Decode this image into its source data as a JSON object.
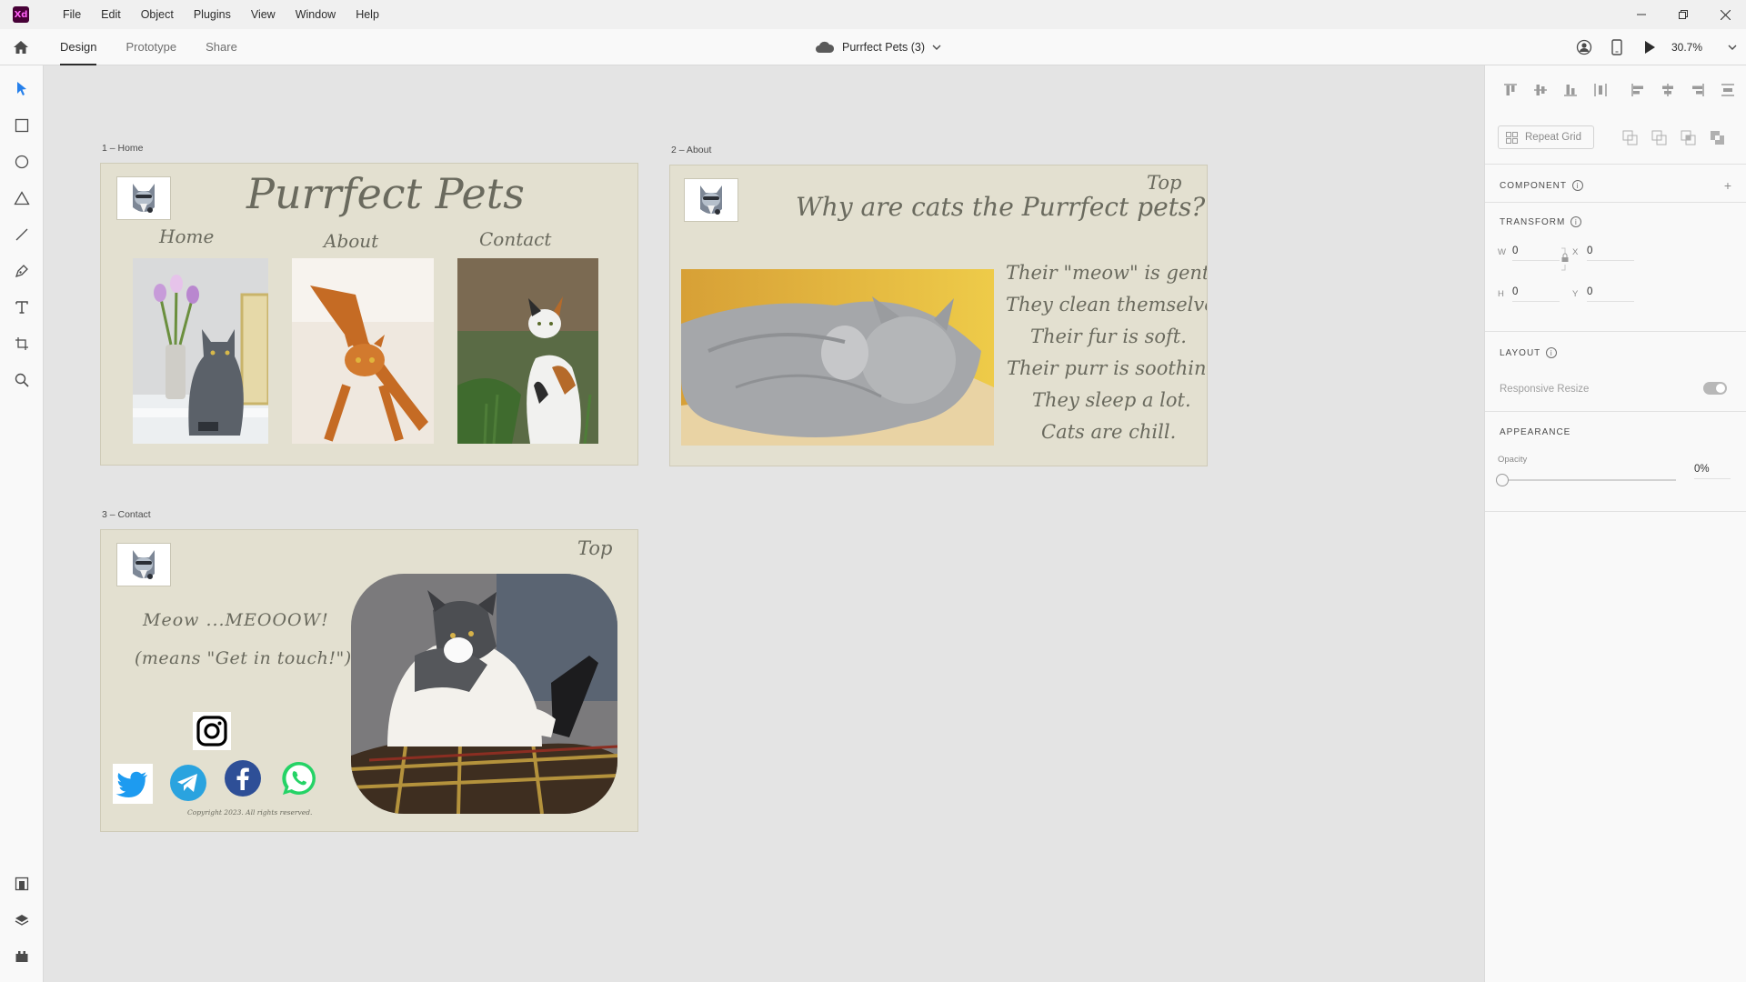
{
  "app": {
    "logo_text": "Xd",
    "document_title": "Purrfect Pets (3)",
    "zoom": "30.7%"
  },
  "menu": [
    "File",
    "Edit",
    "Object",
    "Plugins",
    "View",
    "Window",
    "Help"
  ],
  "tabs": [
    {
      "label": "Design",
      "active": true
    },
    {
      "label": "Prototype",
      "active": false
    },
    {
      "label": "Share",
      "active": false
    }
  ],
  "artboards": {
    "home": {
      "label": "1 – Home",
      "title": "Purrfect Pets",
      "nav": {
        "home": "Home",
        "about": "About",
        "contact": "Contact"
      }
    },
    "about": {
      "label": "2 – About",
      "top_link": "Top",
      "heading": "Why are cats the Purrfect pets?",
      "reasons": [
        "Their \"meow\" is gentle.",
        "They clean themselves.",
        "Their fur is soft.",
        "Their purr is soothing.",
        "They sleep a lot.",
        "Cats are chill."
      ]
    },
    "contact": {
      "label": "3 – Contact",
      "top_link": "Top",
      "line1": "Meow ...MEOOOW!",
      "line2": "(means \"Get in touch!\")",
      "copyright": "Copyright 2023. All rights reserved."
    }
  },
  "panel": {
    "repeat_grid": "Repeat Grid",
    "component": "COMPONENT",
    "transform": "TRANSFORM",
    "w_label": "W",
    "w_value": "0",
    "x_label": "X",
    "x_value": "0",
    "h_label": "H",
    "h_value": "0",
    "y_label": "Y",
    "y_value": "0",
    "layout": "LAYOUT",
    "responsive_resize": "Responsive Resize",
    "appearance": "APPEARANCE",
    "opacity_label": "Opacity",
    "opacity_value": "0%"
  },
  "colors": {
    "accent": "#2680eb",
    "artboard_bg": "#e3e0d0",
    "script_text": "#6a6a5e"
  }
}
